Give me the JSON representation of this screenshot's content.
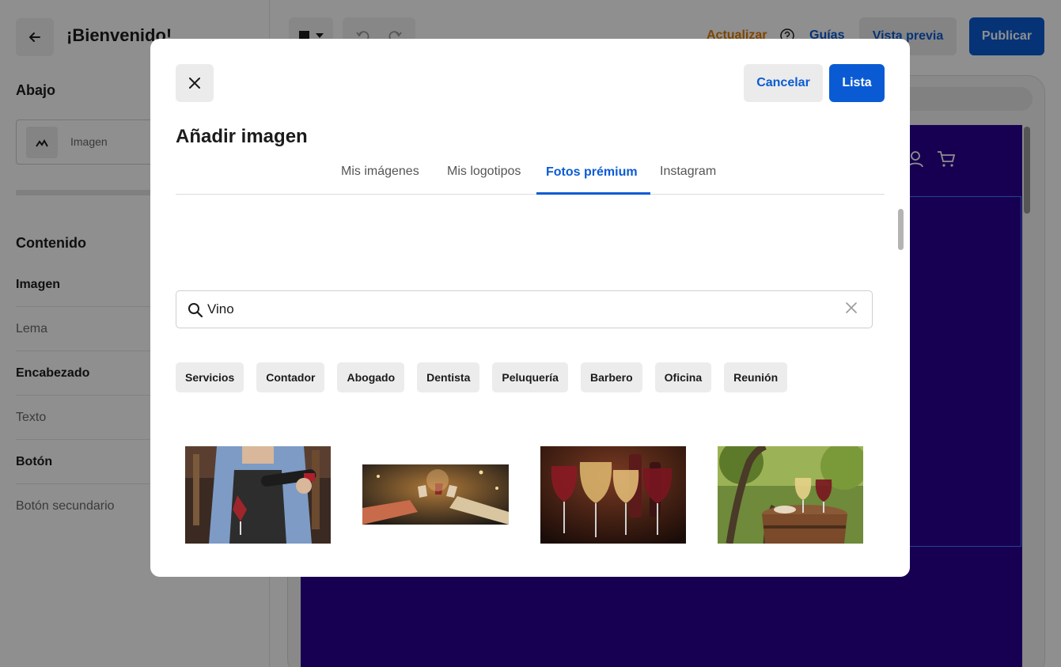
{
  "editor": {
    "panel_title": "¡Bienvenido!",
    "layout_section": "Abajo",
    "layout_option": "Imagen",
    "content_section": "Contenido",
    "content_items": [
      {
        "label": "Imagen",
        "weight": "bold"
      },
      {
        "label": "Lema",
        "weight": "light"
      },
      {
        "label": "Encabezado",
        "weight": "bold"
      },
      {
        "label": "Texto",
        "weight": "light"
      },
      {
        "label": "Botón",
        "weight": "bold"
      },
      {
        "label": "Botón secundario",
        "weight": "light"
      }
    ],
    "toolbar": {
      "upgrade": "Actualizar",
      "guides": "Guías",
      "preview": "Vista previa",
      "publish": "Publicar"
    }
  },
  "modal": {
    "title": "Añadir imagen",
    "cancel_label": "Cancelar",
    "done_label": "Lista",
    "tabs": [
      {
        "label": "Mis imágenes",
        "active": false
      },
      {
        "label": "Mis logotipos",
        "active": false
      },
      {
        "label": "Fotos prémium",
        "active": true
      },
      {
        "label": "Instagram",
        "active": false
      }
    ],
    "search": {
      "value": "Vino"
    },
    "suggestions": [
      "Servicios",
      "Contador",
      "Abogado",
      "Dentista",
      "Peluquería",
      "Barbero",
      "Oficina",
      "Reunión"
    ],
    "photos": [
      {
        "subject": "sommelier-pouring-wine"
      },
      {
        "subject": "friends-toasting-wine"
      },
      {
        "subject": "wine-glasses-row"
      },
      {
        "subject": "wine-glasses-on-barrel"
      }
    ]
  },
  "colors": {
    "accent": "#0a5bd3",
    "upgrade": "#e07b00",
    "site_background": "#2a0093"
  },
  "icons": [
    "back-arrow-icon",
    "close-icon",
    "search-icon",
    "clear-icon",
    "user-icon",
    "cart-icon",
    "layout-icon",
    "help-icon",
    "undo-icon",
    "redo-icon"
  ]
}
